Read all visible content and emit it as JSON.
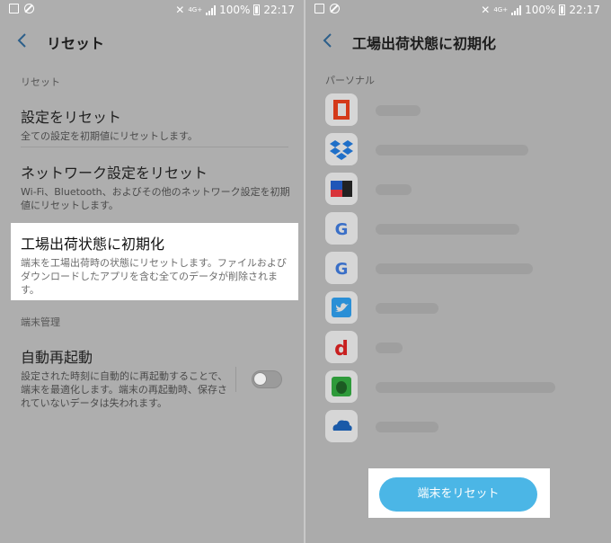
{
  "status_bar": {
    "battery": "100%",
    "time": "22:17",
    "network": "4G+"
  },
  "left": {
    "title": "リセット",
    "section_reset": "リセット",
    "items": [
      {
        "title": "設定をリセット",
        "sub": "全ての設定を初期値にリセットします。"
      },
      {
        "title": "ネットワーク設定をリセット",
        "sub": "Wi-Fi、Bluetooth、およびその他のネットワーク設定を初期値にリセットします。"
      },
      {
        "title": "工場出荷状態に初期化",
        "sub": "端末を工場出荷時の状態にリセットします。ファイルおよびダウンロードしたアプリを含む全てのデータが削除されます。"
      }
    ],
    "section_device": "端末管理",
    "auto_restart": {
      "title": "自動再起動",
      "sub": "設定された時刻に自動的に再起動することで、端末を最適化します。端末の再起動時、保存されていないデータは失われます。",
      "enabled": false
    }
  },
  "right": {
    "title": "工場出荷状態に初期化",
    "section": "パーソナル",
    "accounts": [
      {
        "icon": "office-icon"
      },
      {
        "icon": "dropbox-icon"
      },
      {
        "icon": "app-icon"
      },
      {
        "icon": "google-icon"
      },
      {
        "icon": "google-icon"
      },
      {
        "icon": "twitter-icon"
      },
      {
        "icon": "docomo-d-icon"
      },
      {
        "icon": "evernote-icon"
      },
      {
        "icon": "onedrive-icon"
      }
    ],
    "reset_button": "端末をリセット"
  },
  "colors": {
    "accent": "#4bb6e6",
    "dimmed_bg": "#aeaeae"
  }
}
